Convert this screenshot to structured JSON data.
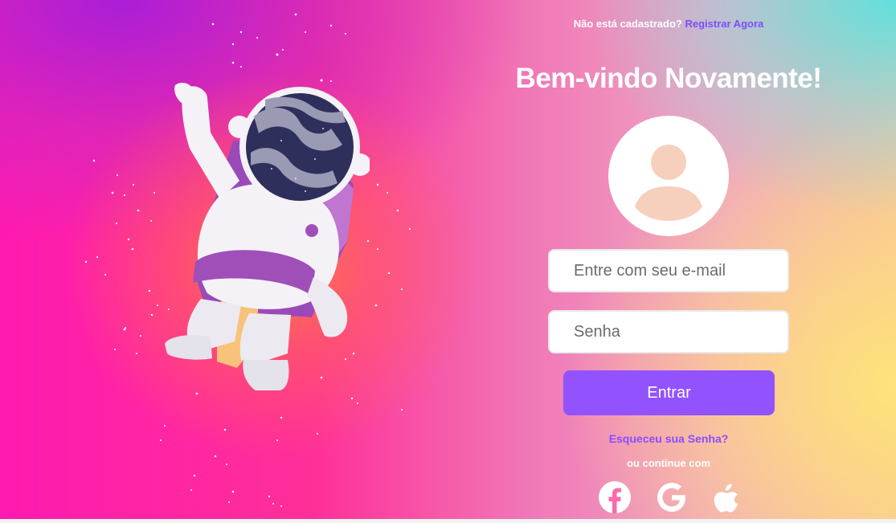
{
  "header": {
    "signup_prompt": "Não está cadastrado?",
    "signup_link": "Registrar Agora"
  },
  "main": {
    "title": "Bem-vindo Novamente!",
    "email_placeholder": "Entre com seu e-mail",
    "password_placeholder": "Senha",
    "login_label": "Entrar",
    "forgot_label": "Esqueceu sua Senha?",
    "continue_label": "ou continue com"
  },
  "social": {
    "icons": [
      "facebook-icon",
      "google-icon",
      "apple-icon"
    ]
  },
  "colors": {
    "accent": "#9253ff",
    "link": "#7b4dff",
    "avatar_fill": "#f7cfbd"
  }
}
